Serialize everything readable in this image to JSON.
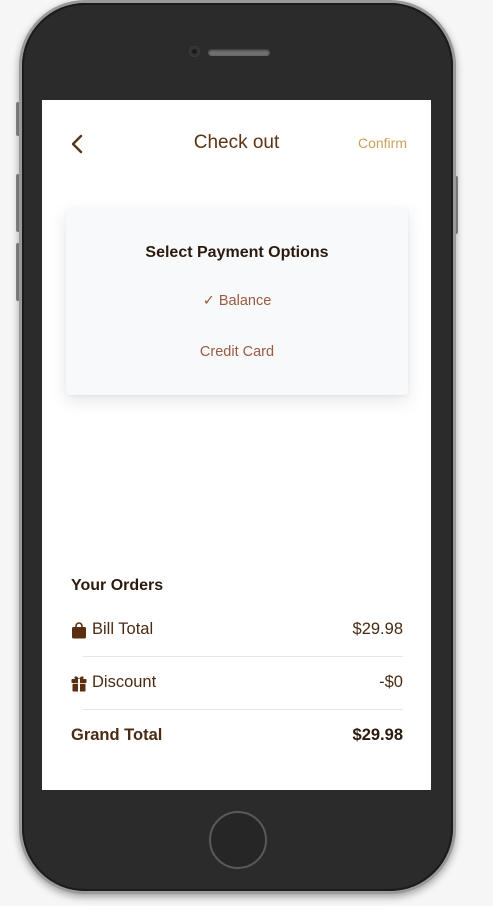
{
  "header": {
    "title": "Check out",
    "confirm_label": "Confirm",
    "back_icon": "chevron-left-icon"
  },
  "payment": {
    "title": "Select Payment Options",
    "options": [
      {
        "label": "✓ Balance",
        "selected": true
      },
      {
        "label": "Credit Card",
        "selected": false
      }
    ]
  },
  "orders": {
    "title": "Your Orders",
    "bill_total": {
      "label": "Bill Total",
      "value": "$29.98",
      "icon": "shopping-bag-icon"
    },
    "discount": {
      "label": "Discount",
      "value": "-$0",
      "icon": "gift-icon"
    },
    "grand_total": {
      "label": "Grand Total",
      "value": "$29.98"
    }
  },
  "colors": {
    "accent_brown": "#5b3414",
    "confirm_gold": "#c9a05e",
    "option_text": "#9a5a3f",
    "phone_body": "#2b2b2b"
  }
}
